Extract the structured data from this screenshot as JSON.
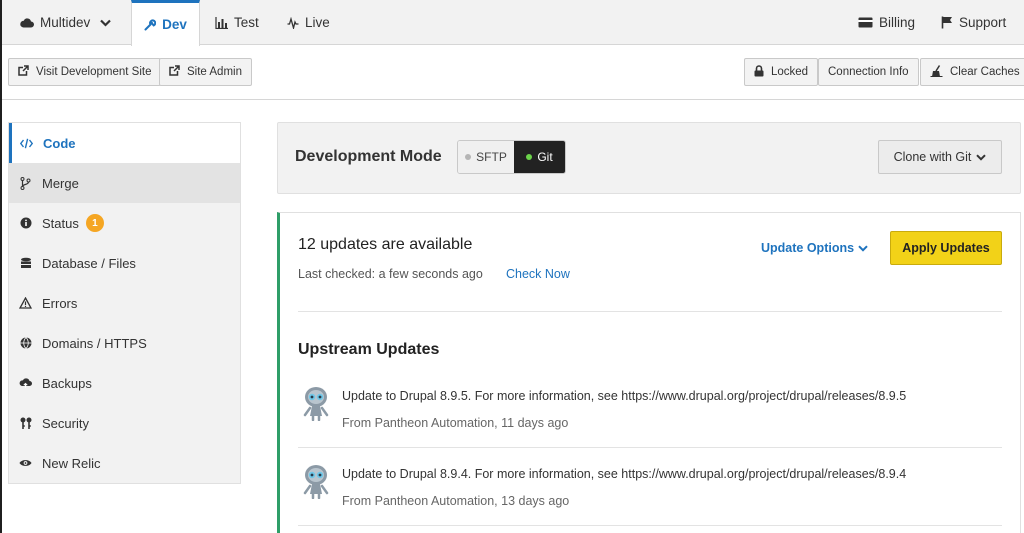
{
  "tabs": {
    "env_selector": "Multidev",
    "dev": "Dev",
    "test": "Test",
    "live": "Live",
    "billing": "Billing",
    "support": "Support"
  },
  "actions": {
    "visit_site": "Visit Development Site",
    "site_admin": "Site Admin",
    "locked": "Locked",
    "connection_info": "Connection Info",
    "clear_caches": "Clear Caches"
  },
  "sidebar": {
    "items": [
      {
        "label": "Code",
        "icon": "code-icon"
      },
      {
        "label": "Merge",
        "icon": "branch-icon"
      },
      {
        "label": "Status",
        "icon": "info-icon",
        "badge": "1"
      },
      {
        "label": "Database / Files",
        "icon": "database-icon"
      },
      {
        "label": "Errors",
        "icon": "warning-icon"
      },
      {
        "label": "Domains / HTTPS",
        "icon": "globe-icon"
      },
      {
        "label": "Backups",
        "icon": "cloud-upload-icon"
      },
      {
        "label": "Security",
        "icon": "keys-icon"
      },
      {
        "label": "New Relic",
        "icon": "eye-icon"
      }
    ]
  },
  "dev_mode": {
    "title": "Development Mode",
    "sftp": "SFTP",
    "git": "Git",
    "clone": "Clone with Git"
  },
  "updates": {
    "title": "12 updates are available",
    "last_checked": "Last checked: a few seconds ago",
    "check_now": "Check Now",
    "update_options": "Update Options",
    "apply": "Apply Updates",
    "upstream_title": "Upstream Updates",
    "commits": [
      {
        "message": "Update to Drupal 8.9.5. For more information, see https://www.drupal.org/project/drupal/releases/8.9.5",
        "meta": "From Pantheon Automation, 11 days ago"
      },
      {
        "message": "Update to Drupal 8.9.4. For more information, see https://www.drupal.org/project/drupal/releases/8.9.4",
        "meta": "From Pantheon Automation, 13 days ago"
      }
    ]
  },
  "colors": {
    "accent": "#1e73be",
    "apply_yellow": "#f2d218",
    "status_green": "#2e9e68",
    "badge_orange": "#f5a623"
  }
}
